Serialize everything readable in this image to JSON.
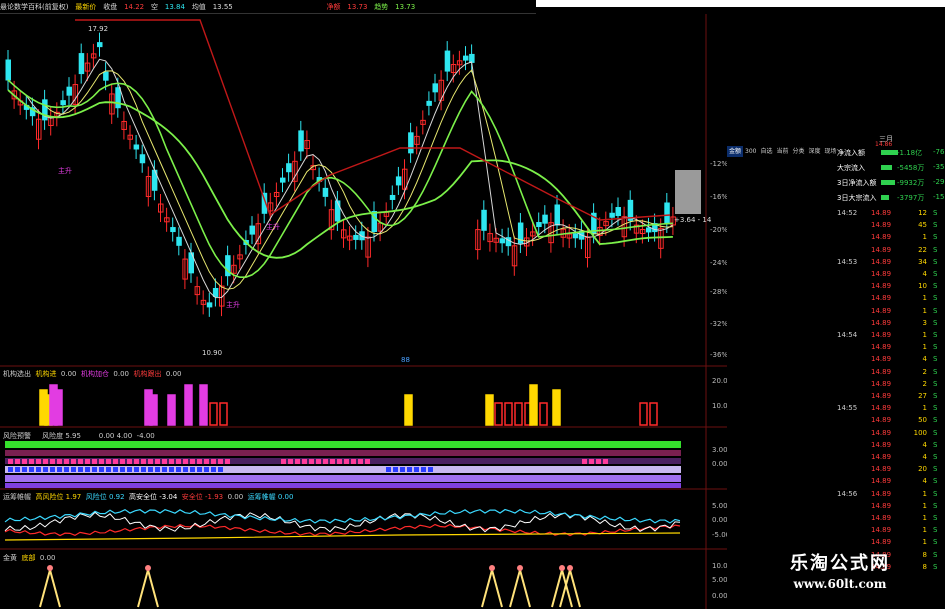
{
  "toolbar": {
    "title": "悬论数学百科(前复权)",
    "price_label": "最新价",
    "items": [
      "收盘",
      "14.22",
      "空",
      "13.84",
      "均值",
      "13.55"
    ],
    "right_items": [
      "净额",
      "13.73",
      "趋势",
      "13.73"
    ]
  },
  "main_chart": {
    "high_mark": "17.92",
    "low_mark": "10.90",
    "ann_1": "主升",
    "ann_2": "主升",
    "ann_3": "主升",
    "last_price_box": "+3.64 - 14",
    "mid_marker": "88",
    "pct_ticks": [
      "-12%",
      "-16%",
      "-20%",
      "-24%",
      "-28%",
      "-32%",
      "-36%"
    ]
  },
  "panel1": {
    "items": [
      {
        "text": "机构选出",
        "color": "#cccccc"
      },
      {
        "text": "机构进",
        "color": "#ffd800"
      },
      {
        "text": "0.00",
        "color": "#cccccc"
      },
      {
        "text": "机构加仓",
        "color": "#e23ce2"
      },
      {
        "text": "0.00",
        "color": "#cccccc"
      },
      {
        "text": "机构跟出",
        "color": "#ff3b3b"
      },
      {
        "text": "0.00",
        "color": "#cccccc"
      }
    ],
    "ticks": [
      "20.00",
      "10.00"
    ]
  },
  "panel2": {
    "items": [
      {
        "text": "风险预警",
        "color": "#cccccc"
      },
      {
        "text": "风险度 5.95",
        "color": "#cccccc"
      },
      {
        "text": "0.00 ",
        "color": "#cccccc"
      },
      {
        "text": "4.00",
        "color": "#cccccc"
      },
      {
        "text": "-4.00",
        "color": "#cccccc"
      }
    ],
    "ticks": [
      "3.00",
      "0.00"
    ]
  },
  "panel3": {
    "items": [
      {
        "text": "运筹帷幄",
        "color": "#cccccc"
      },
      {
        "text": "高风险位 1.97",
        "color": "#ffd800"
      },
      {
        "text": "风险位 0.92",
        "color": "#3bd9ff"
      },
      {
        "text": "高安全位 -3.04",
        "color": "#ffffff"
      },
      {
        "text": "安全位 -1.93",
        "color": "#ff3b3b"
      },
      {
        "text": "0.00",
        "color": "#cccccc"
      },
      {
        "text": "运筹帷幄 0.00",
        "color": "#3bd9ff"
      }
    ],
    "ticks": [
      "5.00",
      "0.00",
      "-5.00"
    ]
  },
  "panel4": {
    "items": [
      {
        "text": "金黄",
        "color": "#cccccc"
      },
      {
        "text": "底部",
        "color": "#ffd800"
      },
      {
        "text": "0.00",
        "color": "#cccccc"
      }
    ],
    "ticks": [
      "10.00",
      "5.00",
      "0.00"
    ]
  },
  "right_panel": {
    "top_label": "三月",
    "top_value": "14.86",
    "tabs": [
      "金额",
      "300",
      "自选",
      "当前",
      "分类",
      "深度",
      "现场"
    ],
    "flows": [
      {
        "label": "净流入额",
        "value": "-1.18亿",
        "extra": "-76",
        "bar": 0.55
      },
      {
        "label": "大宗流入",
        "value": "-5458万",
        "extra": "-35",
        "bar": 0.35
      },
      {
        "label": "3日净流入额",
        "value": "-9932万",
        "extra": "-29",
        "bar": 0.45
      },
      {
        "label": "3日大宗流入",
        "value": "-3797万",
        "extra": "-15",
        "bar": 0.25
      }
    ],
    "trades": [
      {
        "time": "14:52",
        "price": "14.89",
        "vol": "12",
        "side": "S"
      },
      {
        "time": "",
        "price": "14.89",
        "vol": "45",
        "side": "S"
      },
      {
        "time": "",
        "price": "14.89",
        "vol": "1",
        "side": "S"
      },
      {
        "time": "",
        "price": "14.89",
        "vol": "22",
        "side": "S"
      },
      {
        "time": "14:53",
        "price": "14.89",
        "vol": "34",
        "side": "S"
      },
      {
        "time": "",
        "price": "14.89",
        "vol": "4",
        "side": "S"
      },
      {
        "time": "",
        "price": "14.89",
        "vol": "10",
        "side": "S"
      },
      {
        "time": "",
        "price": "14.89",
        "vol": "1",
        "side": "S"
      },
      {
        "time": "",
        "price": "14.89",
        "vol": "1",
        "side": "S"
      },
      {
        "time": "",
        "price": "14.89",
        "vol": "3",
        "side": "S"
      },
      {
        "time": "14:54",
        "price": "14.89",
        "vol": "1",
        "side": "S"
      },
      {
        "time": "",
        "price": "14.89",
        "vol": "1",
        "side": "S"
      },
      {
        "time": "",
        "price": "14.89",
        "vol": "4",
        "side": "S"
      },
      {
        "time": "",
        "price": "14.89",
        "vol": "2",
        "side": "S"
      },
      {
        "time": "",
        "price": "14.89",
        "vol": "2",
        "side": "S"
      },
      {
        "time": "",
        "price": "14.89",
        "vol": "27",
        "side": "S"
      },
      {
        "time": "14:55",
        "price": "14.89",
        "vol": "1",
        "side": "S"
      },
      {
        "time": "",
        "price": "14.89",
        "vol": "50",
        "side": "S"
      },
      {
        "time": "",
        "price": "14.89",
        "vol": "100",
        "side": "S"
      },
      {
        "time": "",
        "price": "14.89",
        "vol": "4",
        "side": "S"
      },
      {
        "time": "",
        "price": "14.89",
        "vol": "4",
        "side": "S"
      },
      {
        "time": "",
        "price": "14.89",
        "vol": "20",
        "side": "S"
      },
      {
        "time": "",
        "price": "14.89",
        "vol": "4",
        "side": "S"
      },
      {
        "time": "14:56",
        "price": "14.89",
        "vol": "1",
        "side": "S"
      },
      {
        "time": "",
        "price": "14.89",
        "vol": "1",
        "side": "S"
      },
      {
        "time": "",
        "price": "14.89",
        "vol": "1",
        "side": "S"
      },
      {
        "time": "",
        "price": "14.89",
        "vol": "1",
        "side": "S"
      },
      {
        "time": "",
        "price": "14.89",
        "vol": "1",
        "side": "S"
      },
      {
        "time": "",
        "price": "14.89",
        "vol": "8",
        "side": "S"
      },
      {
        "time": "",
        "price": "14.89",
        "vol": "8",
        "side": "S"
      }
    ]
  },
  "watermark": {
    "line1": "乐淘公式网",
    "line2": "www.60lt.com"
  },
  "colors": {
    "up": "#ff2a2a",
    "down": "#2ee6f0",
    "ma_green": "#7cf04a",
    "ma_white": "#d8d8d8",
    "resistance": "#c01818"
  }
}
